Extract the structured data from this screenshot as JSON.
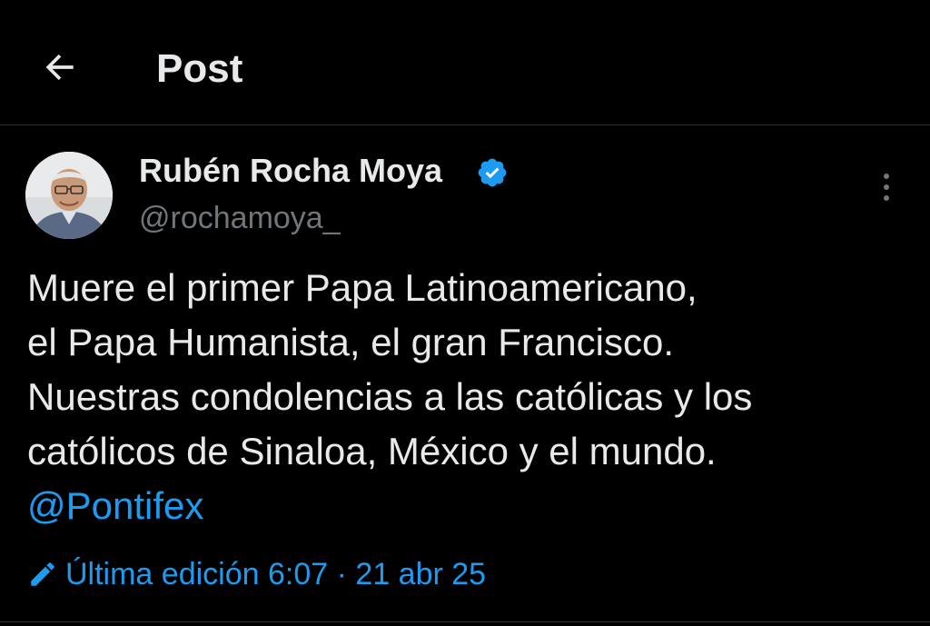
{
  "header": {
    "title": "Post",
    "back_icon": "arrow-left-icon"
  },
  "post": {
    "author": {
      "name": "Rubén Rocha Moya",
      "handle": "@rochamoya_",
      "verified": true,
      "verified_color": "#1d9bf0"
    },
    "text_lines": [
      "Muere el primer Papa Latinoamericano,",
      "el Papa Humanista, el gran Francisco.",
      "Nuestras condolencias a las católicas y los",
      "católicos de Sinaloa, México y el mundo."
    ],
    "mention": "@Pontifex",
    "edited": {
      "label": "Última edición",
      "time": "6:07",
      "separator": "·",
      "date": "21 abr 25"
    }
  },
  "colors": {
    "background": "#000000",
    "text": "#e7e9ea",
    "muted": "#71767b",
    "accent": "#1d9bf0",
    "divider": "#2f3336"
  }
}
